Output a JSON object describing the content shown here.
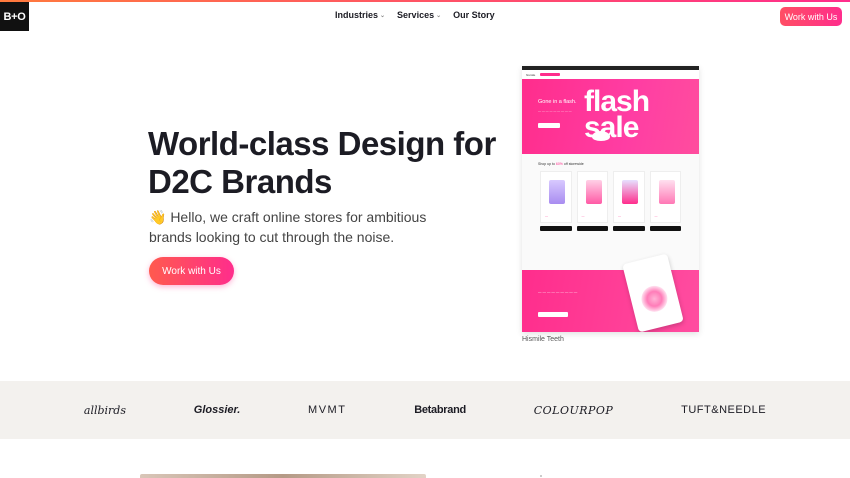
{
  "header": {
    "logo": "B+O",
    "nav": [
      {
        "label": "Industries",
        "dropdown": true
      },
      {
        "label": "Services",
        "dropdown": true
      },
      {
        "label": "Our Story",
        "dropdown": false
      }
    ],
    "cta": "Work with Us"
  },
  "hero": {
    "title": "World-class Design for D2C Brands",
    "subtitle": "👋 Hello, we craft online stores for ambitious brands looking to cut through the noise.",
    "cta": "Work with Us"
  },
  "showcase": {
    "banner_title": "Gone in a flash.",
    "banner_big": "flash sale",
    "shop_text": "Shop up to ",
    "shop_pct": "60%",
    "shop_rest": " off storewide",
    "caption": "Hismile Teeth"
  },
  "brands": [
    "allbirds",
    "Glossier.",
    "MVMT",
    "Betabrand",
    "COLOURPOP",
    "TUFT&NEEDLE"
  ],
  "colors": {
    "accent": "#ff2d8c",
    "accent_orange": "#ff7a3d",
    "logos_bg": "#f3f1ee"
  }
}
